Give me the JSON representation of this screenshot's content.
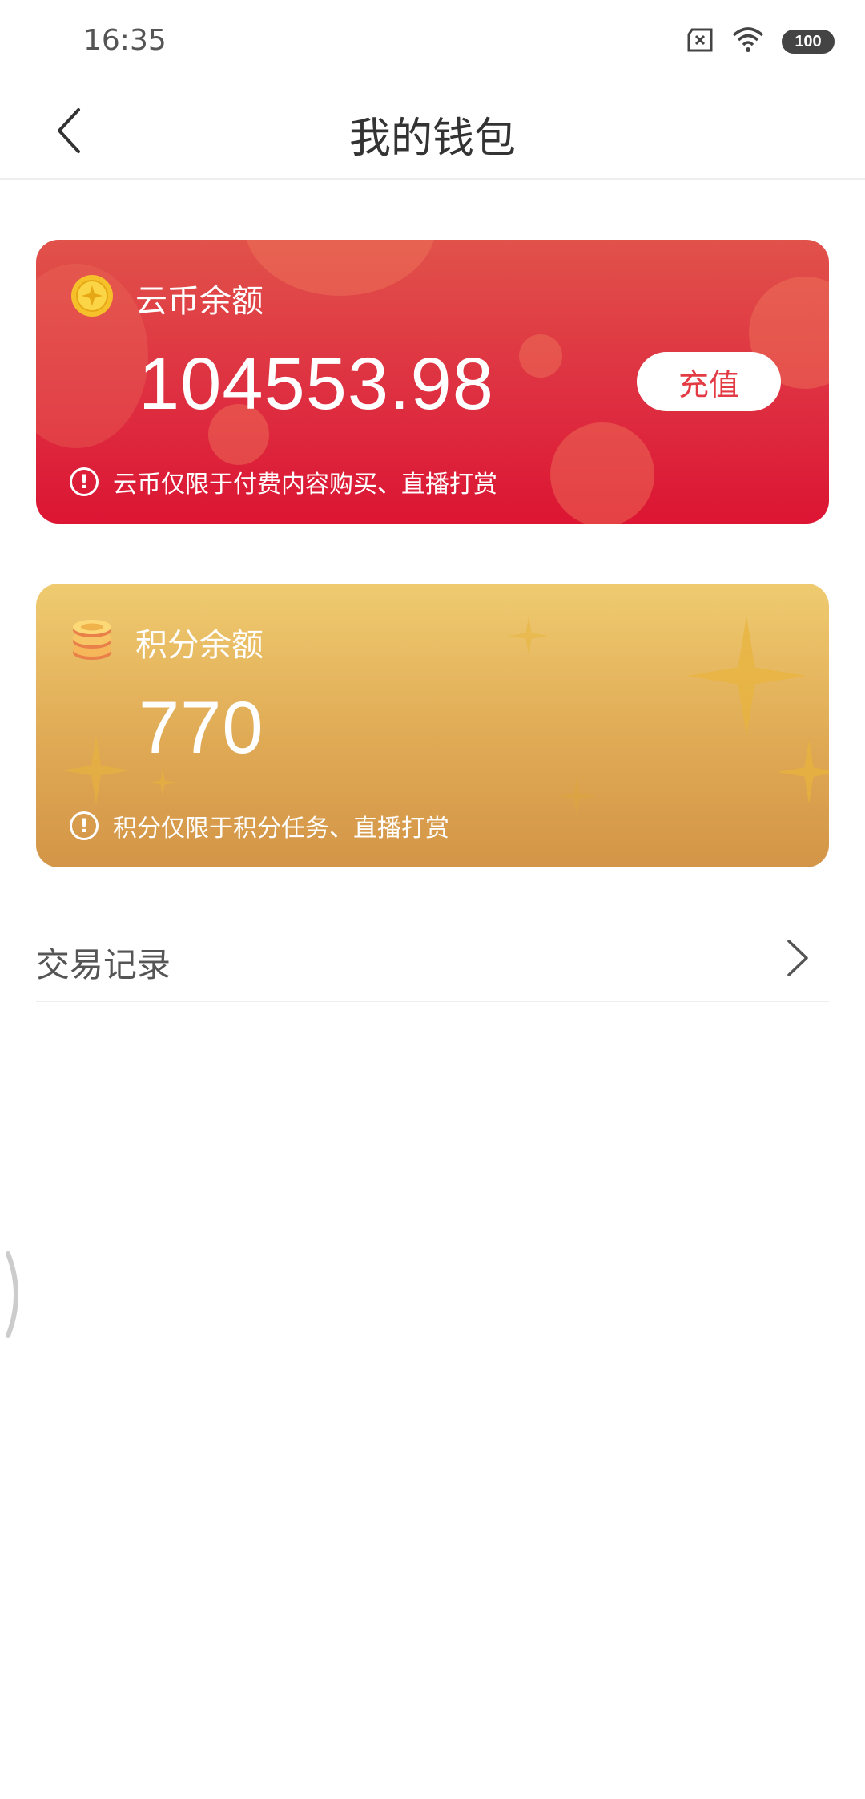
{
  "status_bar": {
    "time": "16:35",
    "battery": "100",
    "icons": [
      "sim-error-icon",
      "wifi-icon",
      "battery-icon"
    ]
  },
  "nav": {
    "title": "我的钱包",
    "back_icon": "back-arrow-icon"
  },
  "coin_card": {
    "label": "云币余额",
    "amount": "104553.98",
    "recharge_label": "充值",
    "note": "云币仅限于付费内容购买、直播打赏",
    "icon": "gold-coin-icon",
    "colors": {
      "top": "#e1524a",
      "bottom": "#dc1533",
      "button_text": "#e23b44"
    }
  },
  "points_card": {
    "label": "积分余额",
    "amount": "770",
    "note": "积分仅限于积分任务、直播打赏",
    "icon": "coin-stack-icon",
    "colors": {
      "top": "#efcb70",
      "bottom": "#d39547"
    }
  },
  "records": {
    "label": "交易记录",
    "chevron_icon": "chevron-right-icon"
  }
}
